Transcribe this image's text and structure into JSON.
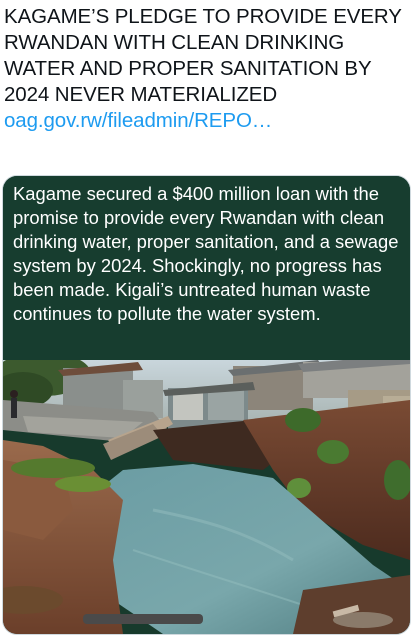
{
  "post": {
    "text": "KAGAME’S PLEDGE TO PROVIDE EVERY RWANDAN WITH CLEAN DRINKING WATER AND PROPER SANITATION BY 2024 NEVER MATERIALIZED",
    "link_text": "oag.gov.rw/fileadmin/REPO…"
  },
  "card": {
    "caption": "Kagame secured a $400 million loan with the promise to provide every Rwandan with clean drinking water, proper sanitation, and a sewage system by 2024. Shockingly, no progress has been made. Kigali’s untreated human waste continues to pollute the water system."
  },
  "colors": {
    "text": "#0f1419",
    "link": "#1d9bf0",
    "caption_bg": "#173d2f",
    "caption_text": "#ffffff"
  }
}
